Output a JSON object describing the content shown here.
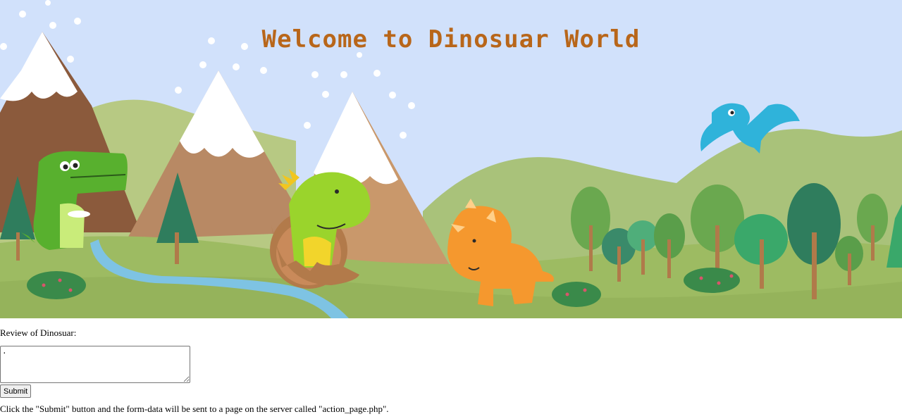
{
  "banner": {
    "title": "Welcome to Dinosuar World",
    "illustration": "dinosaur-landscape"
  },
  "form": {
    "review_label": "Review of Dinosuar:",
    "review_value": ".",
    "submit_label": "Submit"
  },
  "note": "Click the \"Submit\" button and the form-data will be sent to a page on the server called \"action_page.php\".",
  "colors": {
    "sky": "#d1e1fb",
    "title": "#b8661a",
    "grass": "#9dbb62",
    "river": "#7ec3e3"
  }
}
